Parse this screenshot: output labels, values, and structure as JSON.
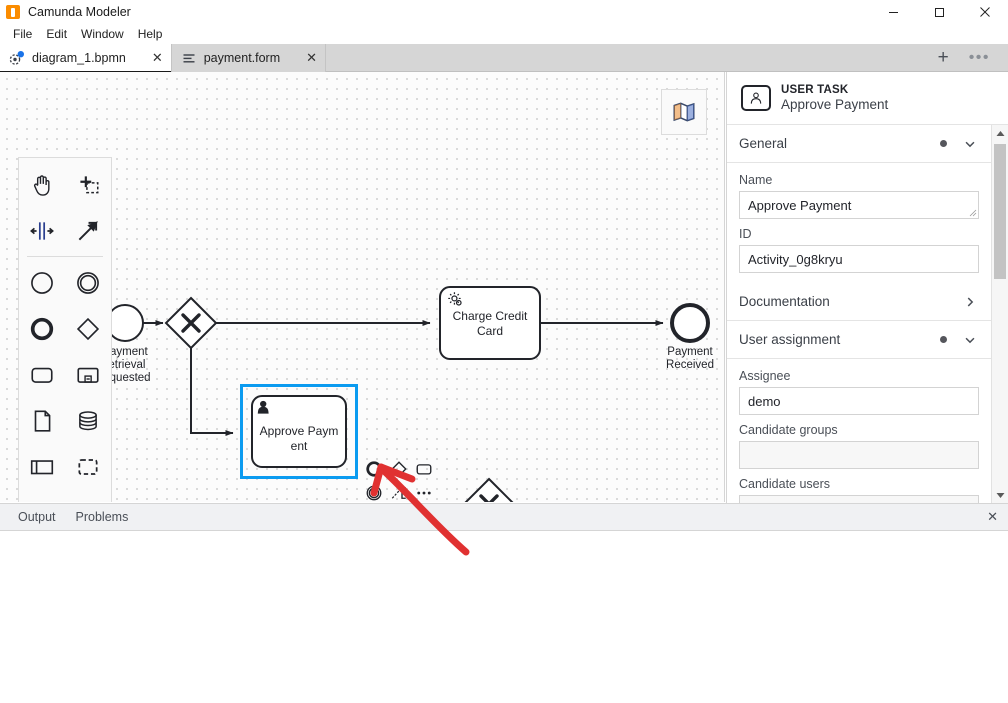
{
  "window": {
    "title": "Camunda Modeler",
    "app_icon": "camunda-logo-icon",
    "controls": {
      "minimize": "minimize-icon",
      "maximize": "maximize-icon",
      "close": "close-icon"
    }
  },
  "menubar": {
    "items": [
      {
        "label": "File"
      },
      {
        "label": "Edit"
      },
      {
        "label": "Window"
      },
      {
        "label": "Help"
      }
    ]
  },
  "tabbar": {
    "tabs": [
      {
        "label": "diagram_1.bpmn",
        "icon": "bpmn-diagram-icon",
        "active": true,
        "close": "✕"
      },
      {
        "label": "payment.form",
        "icon": "form-icon",
        "active": false,
        "close": "✕"
      }
    ],
    "new_tab": "+",
    "more": "•••"
  },
  "palette": {
    "tools": [
      {
        "name": "hand-tool",
        "title": "Activate the hand tool"
      },
      {
        "name": "lasso-tool",
        "title": "Activate the lasso tool"
      },
      {
        "name": "space-tool",
        "title": "Activate the create/remove space tool"
      },
      {
        "name": "global-connect-tool",
        "title": "Activate the global connect tool"
      }
    ],
    "elements": [
      {
        "name": "create-start-event",
        "title": "Create start event"
      },
      {
        "name": "create-intermediate-event",
        "title": "Create intermediate/boundary event"
      },
      {
        "name": "create-end-event",
        "title": "Create end event"
      },
      {
        "name": "create-gateway",
        "title": "Create gateway"
      },
      {
        "name": "create-task",
        "title": "Create task"
      },
      {
        "name": "create-subprocess-collapsed",
        "title": "Create collapsed sub-process"
      },
      {
        "name": "create-data-object",
        "title": "Create data object reference"
      },
      {
        "name": "create-data-store",
        "title": "Create data store reference"
      },
      {
        "name": "create-participant",
        "title": "Create pool/participant"
      },
      {
        "name": "create-group",
        "title": "Create group"
      }
    ],
    "more": "•••"
  },
  "canvas": {
    "minimap_button": "minimap-icon",
    "elements": [
      {
        "id": "start-event",
        "type": "start-event",
        "label": "Payment retrieval requested"
      },
      {
        "id": "gateway-1",
        "type": "exclusive-gateway",
        "label": ""
      },
      {
        "id": "charge-credit-card",
        "type": "service-task",
        "label": "Charge Credit Card"
      },
      {
        "id": "payment-received",
        "type": "end-event",
        "label": "Payment Received"
      },
      {
        "id": "approve-payment",
        "type": "user-task",
        "label": "Approve Payment",
        "selected": true
      },
      {
        "id": "gateway-2",
        "type": "exclusive-gateway",
        "label": ""
      }
    ]
  },
  "context_pad": {
    "items": [
      {
        "name": "append-end-event",
        "icon": "end-event-icon"
      },
      {
        "name": "append-gateway",
        "icon": "gateway-icon"
      },
      {
        "name": "append-task",
        "icon": "task-icon"
      },
      {
        "name": "append-intermediate-event",
        "icon": "intermediate-event-icon"
      },
      {
        "name": "append-text-annotation",
        "icon": "text-annotation-icon"
      },
      {
        "name": "more-append-options",
        "icon": "ellipsis-icon"
      },
      {
        "name": "change-element-type",
        "icon": "wrench-icon"
      },
      {
        "name": "delete-element",
        "icon": "trash-icon"
      },
      {
        "name": "set-color",
        "icon": "paintbrush-icon"
      },
      {
        "name": "connect-tool",
        "icon": "connect-arrow-icon",
        "hovered": true
      }
    ]
  },
  "bottom_panel": {
    "tabs": [
      {
        "label": "Output"
      },
      {
        "label": "Problems"
      }
    ],
    "close": "✕"
  },
  "properties": {
    "header": {
      "type": "USER TASK",
      "name": "Approve Payment",
      "icon": "user-task-icon"
    },
    "groups": [
      {
        "title": "General",
        "expanded": true,
        "has_dot": true,
        "chevron": "chevron-down-icon",
        "fields": [
          {
            "label": "Name",
            "value": "Approve Payment",
            "multiline": true
          },
          {
            "label": "ID",
            "value": "Activity_0g8kryu",
            "multiline": false
          }
        ]
      },
      {
        "title": "Documentation",
        "expanded": false,
        "has_dot": false,
        "chevron": "chevron-right-icon",
        "fields": []
      },
      {
        "title": "User assignment",
        "expanded": true,
        "has_dot": true,
        "chevron": "chevron-down-icon",
        "fields": [
          {
            "label": "Assignee",
            "value": "demo",
            "multiline": false
          },
          {
            "label": "Candidate groups",
            "value": "",
            "multiline": false
          },
          {
            "label": "Candidate users",
            "value": "",
            "multiline": false
          }
        ]
      }
    ],
    "scrollbar": {
      "up": "scroll-up-arrow-icon",
      "down": "scroll-down-arrow-icon"
    }
  },
  "colors": {
    "accent": "#1a73e8",
    "selection": "#0b9bf0",
    "annotation": "#e03131",
    "brand": "#fb8c00",
    "stroke": "#22242a"
  }
}
